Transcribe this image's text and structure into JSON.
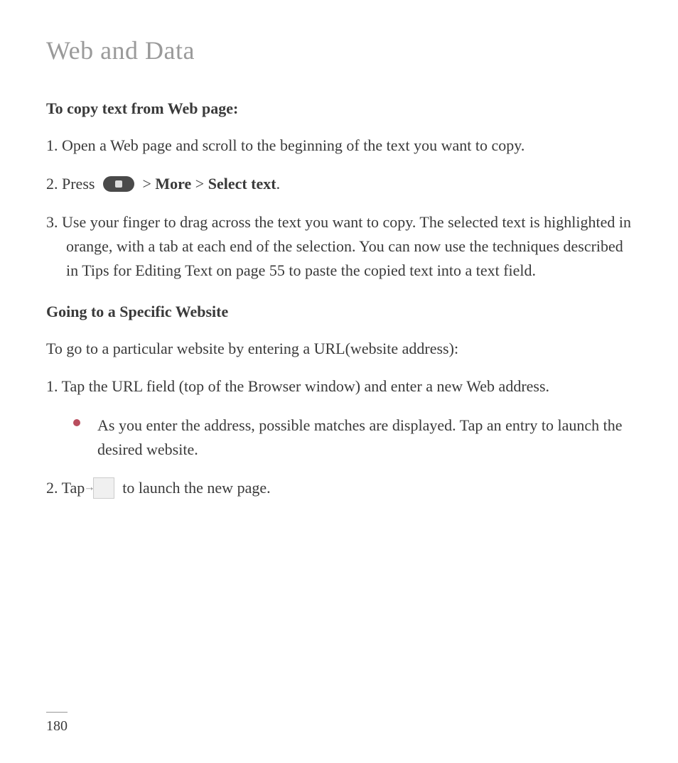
{
  "title": "Web and Data",
  "section1": {
    "heading": "To copy text from Web page:",
    "step1": "1. Open a Web page and scroll to the beginning of the text you want to copy.",
    "step2_prefix": "2. Press ",
    "step2_gt1": " > ",
    "step2_more": "More",
    "step2_gt2": " > ",
    "step2_select": "Select text",
    "step2_period": ".",
    "step3": "3. Use your finger to drag across the text you want to copy. The selected text is highlighted in orange, with a tab at each end of the selection. You can now use the techniques described in Tips for Editing Text on page 55 to paste the copied text into a text field."
  },
  "section2": {
    "heading": "Going to a Specific Website",
    "intro": "To go to a particular website by entering a URL(website address):",
    "step1": "1. Tap the URL field (top of the Browser window) and enter a new Web address.",
    "bullet1": "As you enter the address, possible matches are displayed. Tap an entry to launch the desired website.",
    "step2_prefix": "2. Tap ",
    "step2_suffix": " to launch the new page."
  },
  "pageNumber": "180"
}
